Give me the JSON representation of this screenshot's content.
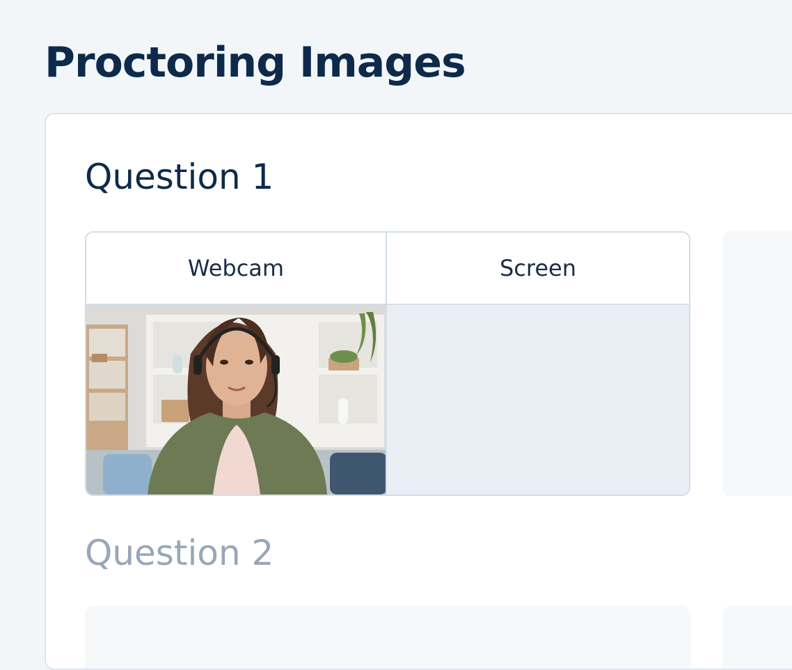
{
  "page": {
    "title": "Proctoring Images"
  },
  "questions": [
    {
      "heading": "Question 1",
      "columns": {
        "webcam_label": "Webcam",
        "screen_label": "Screen"
      }
    },
    {
      "heading": "Question 2"
    }
  ],
  "colors": {
    "title": "#0d2a4a",
    "muted_heading": "#97a7b8",
    "border": "#d3dde7",
    "screen_placeholder": "#eaeff5",
    "background": "#f3f6f9"
  }
}
